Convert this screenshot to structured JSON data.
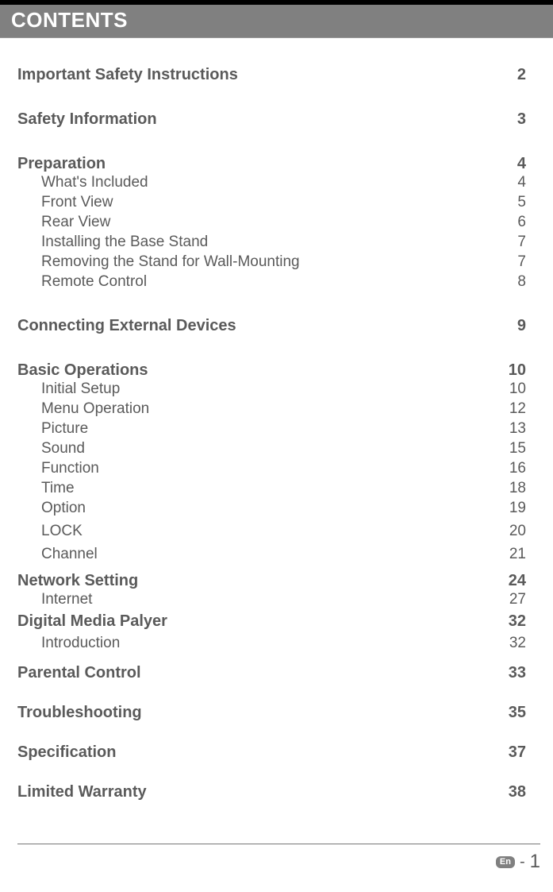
{
  "header": {
    "title": "CONTENTS"
  },
  "toc": {
    "s1": {
      "title": "Important Safety Instructions",
      "page": "2"
    },
    "s2": {
      "title": "Safety Information",
      "page": "3"
    },
    "s3": {
      "title": "Preparation",
      "page": "4",
      "items": [
        {
          "label": "What's Included",
          "page": "4"
        },
        {
          "label": "Front View",
          "page": "5"
        },
        {
          "label": "Rear View",
          "page": "6"
        },
        {
          "label": "Installing the Base Stand",
          "page": "7"
        },
        {
          "label": "Removing the Stand for Wall-Mounting",
          "page": "7"
        },
        {
          "label": "Remote Control",
          "page": "8"
        }
      ]
    },
    "s4": {
      "title": "Connecting External Devices",
      "page": "9"
    },
    "s5": {
      "title": "Basic Operations",
      "page": "10",
      "items": [
        {
          "label": "Initial Setup",
          "page": "10"
        },
        {
          "label": "Menu Operation",
          "page": "12"
        },
        {
          "label": "Picture",
          "page": "13"
        },
        {
          "label": "Sound",
          "page": "15"
        },
        {
          "label": "Function",
          "page": "16"
        },
        {
          "label": "Time",
          "page": "18"
        },
        {
          "label": "Option",
          "page": "19"
        },
        {
          "label": "LOCK",
          "page": "20"
        },
        {
          "label": "Channel",
          "page": "21"
        }
      ]
    },
    "s6": {
      "title": "Network Setting",
      "page": "24",
      "items": [
        {
          "label": "Internet",
          "page": "27"
        }
      ]
    },
    "s7": {
      "title": "Digital Media Palyer",
      "page": "32",
      "items": [
        {
          "label": "Introduction",
          "page": "32"
        }
      ]
    },
    "s8": {
      "title": "Parental Control",
      "page": "33"
    },
    "s9": {
      "title": "Troubleshooting",
      "page": "35"
    },
    "s10": {
      "title": "Specification",
      "page": "37"
    },
    "s11": {
      "title": "Limited Warranty",
      "page": "38"
    }
  },
  "footer": {
    "lang_badge": "En",
    "dash": "-",
    "page_number": "1"
  }
}
